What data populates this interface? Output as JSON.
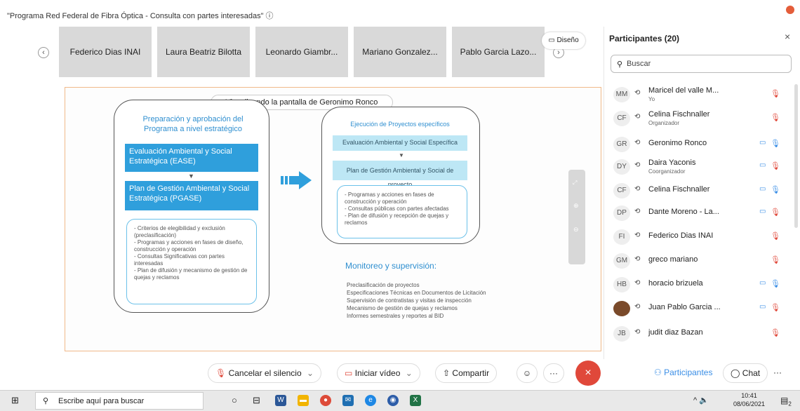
{
  "window": {
    "title": "\"Programa Red Federal de Fibra Óptica - Consulta con partes interesadas\" ⓘ"
  },
  "strip": {
    "prev": "‹",
    "next": "›",
    "tiles": [
      "Federico Dias INAI",
      "Laura Beatriz Bilotta",
      "Leonardo Giambr...",
      "Mariano Gonzalez...",
      "Pablo Garcia Lazo..."
    ],
    "layout_label": "Diseño"
  },
  "screen_share": {
    "banner": "Visualizando la pantalla de Geronimo Ronco"
  },
  "slide": {
    "left_heading": "Preparación y aprobación del Programa a nivel estratégico",
    "ease": "Evaluación Ambiental y Social Estratégica (EASE)",
    "pgase": "Plan de Gestión Ambiental y Social Estratégica (PGASE)",
    "left_list": "- Criterios de elegibilidad y exclusión (preclasificación)\n- Programas y acciones en fases de diseño, construcción y operación\n- Consultas Significativas con partes interesadas\n- Plan de difusión y mecanismo de gestión de quejas y reclamos",
    "right_heading": "Ejecución de Proyectos específicos",
    "eas": "Evaluación Ambiental y Social Específica",
    "pgap": "Plan de Gestión Ambiental y Social de proyecto",
    "right_list": "- Programas y acciones en fases de construcción y operación\n- Consultas públicas con partes afectadas\n- Plan de difusión y recepción de quejas y reclamos",
    "monitor_heading": "Monitoreo y supervisión:",
    "monitor_list": "Preclasificación de proyectos\nEspecificaciones Técnicas en Documentos de Licitación\nSupervisión de contratistas y visitas de inspección\nMecanismo de gestión de quejas y reclamos\nInformes semestrales y reportes al BID"
  },
  "participants": {
    "title": "Participantes (20)",
    "close": "×",
    "search_placeholder": "Buscar",
    "list": [
      {
        "initials": "MM",
        "name": "Maricel del valle M...",
        "sub": "Yo",
        "cam": "",
        "mic": "muted"
      },
      {
        "initials": "CF",
        "name": "Celina Fischnaller",
        "sub": "Organizador",
        "cam": "",
        "mic": "muted"
      },
      {
        "initials": "GR",
        "name": "Geronimo Ronco",
        "sub": "",
        "cam": "on",
        "mic": "on"
      },
      {
        "initials": "DY",
        "name": "Daira Yaconis",
        "sub": "Coorganizador",
        "cam": "on",
        "mic": "muted"
      },
      {
        "initials": "CF",
        "name": "Celina Fischnaller",
        "sub": "",
        "cam": "on",
        "mic": "on"
      },
      {
        "initials": "DP",
        "name": "Dante Moreno - La...",
        "sub": "",
        "cam": "on",
        "mic": "muted"
      },
      {
        "initials": "FI",
        "name": "Federico Dias INAI",
        "sub": "",
        "cam": "",
        "mic": "muted"
      },
      {
        "initials": "GM",
        "name": "greco mariano",
        "sub": "",
        "cam": "",
        "mic": "muted"
      },
      {
        "initials": "HB",
        "name": "horacio brizuela",
        "sub": "",
        "cam": "on",
        "mic": "on"
      },
      {
        "initials": "",
        "name": "Juan Pablo Garcia ...",
        "sub": "",
        "cam": "on",
        "mic": "muted"
      },
      {
        "initials": "JB",
        "name": "judit diaz Bazan",
        "sub": "",
        "cam": "",
        "mic": "muted"
      }
    ]
  },
  "controls": {
    "unmute": "Cancelar el silencio",
    "video": "Iniciar vídeo",
    "share": "Compartir",
    "more": "···",
    "participants": "Participantes",
    "chat": "Chat",
    "panel_more": "···",
    "end": "×"
  },
  "taskbar": {
    "search_placeholder": "Escribe aquí para buscar",
    "time": "10:41",
    "date": "08/06/2021",
    "notif_count": "2"
  }
}
